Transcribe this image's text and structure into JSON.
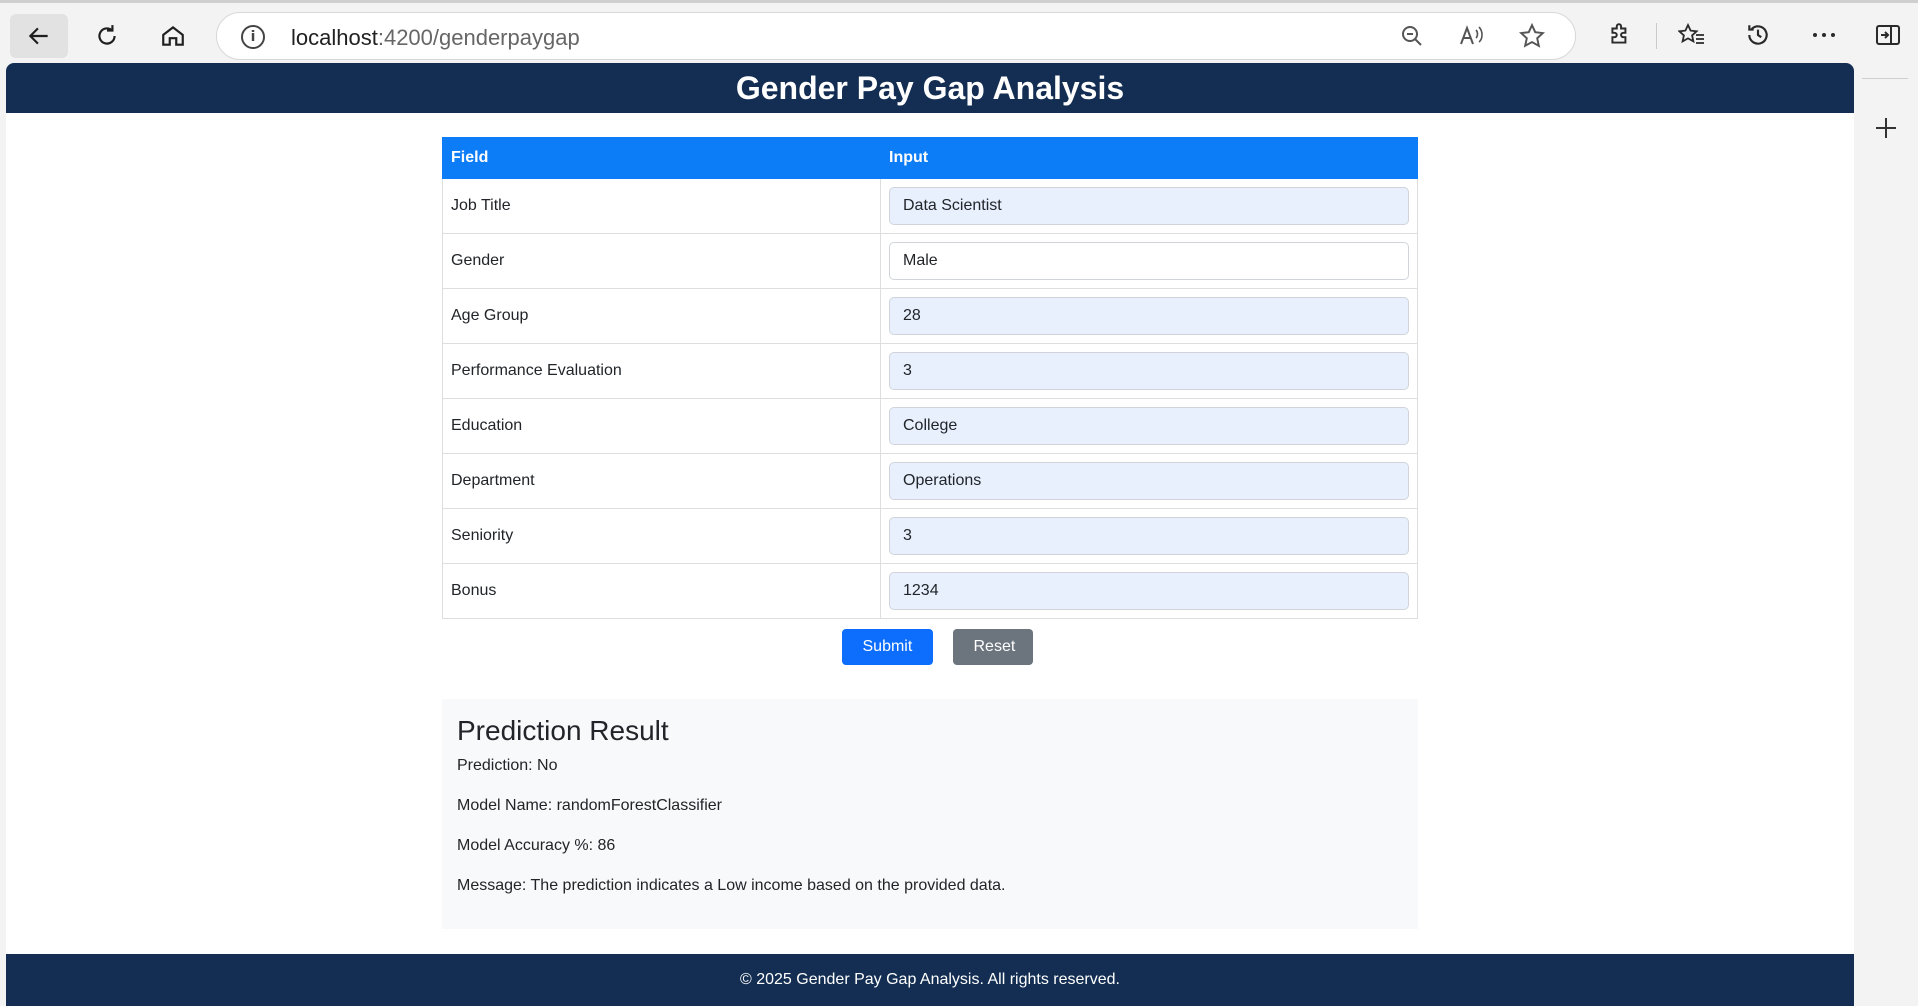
{
  "browser": {
    "url_host": "localhost",
    "url_path": ":4200/genderpaygap"
  },
  "header": {
    "title": "Gender Pay Gap Analysis"
  },
  "table": {
    "col_field": "Field",
    "col_input": "Input",
    "rows": [
      {
        "label": "Job Title",
        "value": "Data Scientist"
      },
      {
        "label": "Gender",
        "value": "Male"
      },
      {
        "label": "Age Group",
        "value": "28"
      },
      {
        "label": "Performance Evaluation",
        "value": "3"
      },
      {
        "label": "Education",
        "value": "College"
      },
      {
        "label": "Department",
        "value": "Operations"
      },
      {
        "label": "Seniority",
        "value": "3"
      },
      {
        "label": "Bonus",
        "value": "1234"
      }
    ]
  },
  "actions": {
    "submit": "Submit",
    "reset": "Reset"
  },
  "result": {
    "title": "Prediction Result",
    "prediction": "Prediction: No",
    "model_name": "Model Name: randomForestClassifier",
    "model_accuracy": "Model Accuracy %: 86",
    "message": "Message: The prediction indicates a Low income based on the provided data."
  },
  "footer": {
    "text": "© 2025 Gender Pay Gap Analysis. All rights reserved."
  },
  "icons": {
    "back": "arrow-left-icon",
    "reload": "reload-icon",
    "home": "home-icon",
    "info": "info-icon",
    "zoom": "zoom-out-icon",
    "read_aloud": "read-aloud-icon",
    "favorite": "star-icon",
    "extensions": "puzzle-icon",
    "favorites": "favorites-icon",
    "history": "history-icon",
    "more": "more-icon",
    "sidebar": "sidebar-icon",
    "add": "plus-icon"
  },
  "colors": {
    "header_bg": "#132e52",
    "table_header_bg": "#0d7cf7",
    "submit_bg": "#0d6efd",
    "reset_bg": "#6c757d",
    "input_autofill_bg": "#e8f0fe"
  }
}
